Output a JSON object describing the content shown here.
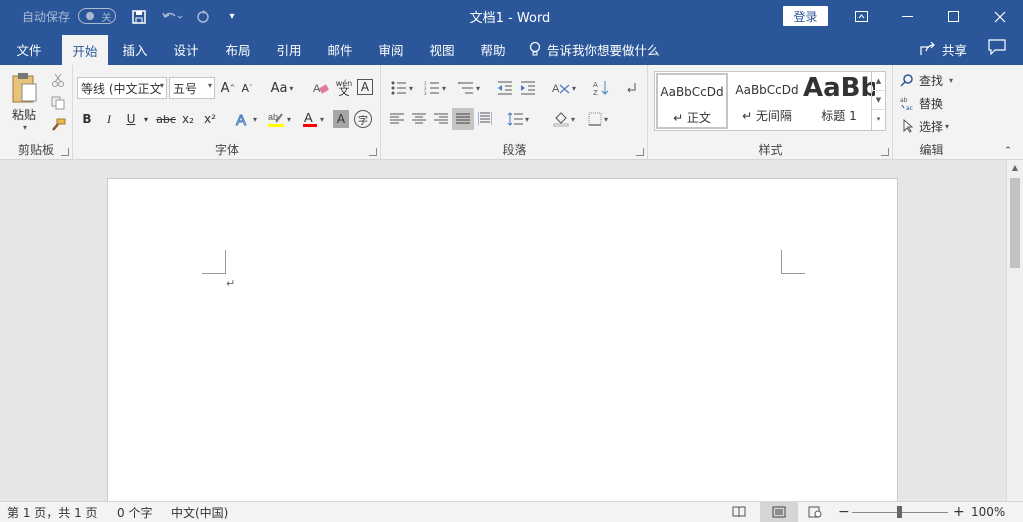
{
  "titlebar": {
    "autosave_label": "自动保存",
    "autosave_state": "关",
    "doc_title": "文档1  -  Word",
    "login": "登录"
  },
  "tabs": [
    "文件",
    "开始",
    "插入",
    "设计",
    "布局",
    "引用",
    "邮件",
    "审阅",
    "视图",
    "帮助"
  ],
  "tell_me": "告诉我你想要做什么",
  "share": "共享",
  "ribbon": {
    "clipboard": {
      "paste": "粘贴",
      "label": "剪贴板"
    },
    "font": {
      "font_name": "等线 (中文正文",
      "font_size": "五号",
      "change_case": "Aa",
      "bold": "B",
      "italic": "I",
      "underline": "U",
      "strike": "abc",
      "subscript": "x₂",
      "superscript": "x²",
      "phonetic": "wén",
      "label": "字体"
    },
    "paragraph": {
      "label": "段落"
    },
    "styles": {
      "items": [
        {
          "preview": "AaBbCcDd",
          "name": "↵ 正文"
        },
        {
          "preview": "AaBbCcDd",
          "name": "↵ 无间隔"
        },
        {
          "preview": "AaBb",
          "name": "标题 1"
        }
      ],
      "label": "样式"
    },
    "editing": {
      "find": "查找",
      "replace": "替换",
      "select": "选择",
      "label": "编辑"
    }
  },
  "document": {
    "paragraph_mark": "↵"
  },
  "statusbar": {
    "page": "第 1 页，共 1 页",
    "words": "0 个字",
    "language": "中文(中国)",
    "zoom": "100%"
  },
  "colors": {
    "brand": "#2b579a",
    "highlight": "#ffff00",
    "font_color": "#ff0000"
  }
}
